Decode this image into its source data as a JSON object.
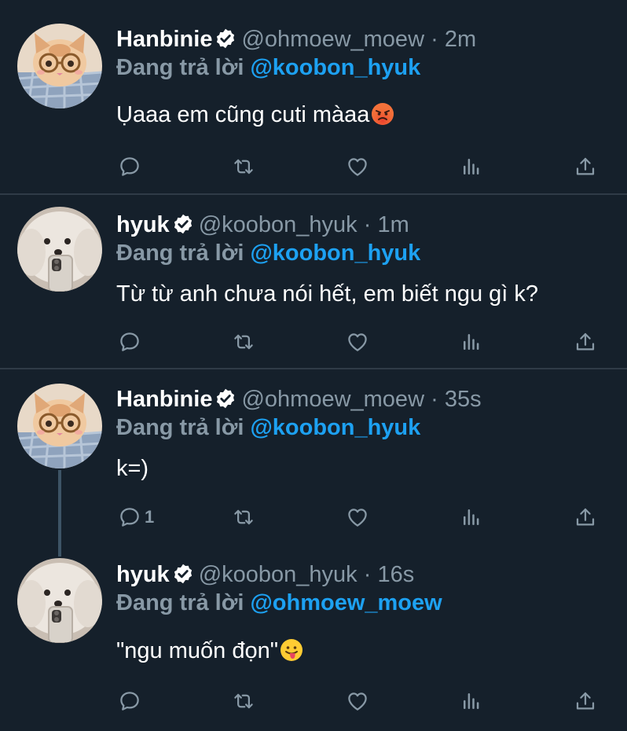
{
  "tweets": [
    {
      "name": "Hanbinie",
      "handle": "@ohmoew_moew",
      "dot": "·",
      "time": "2m",
      "reply_prefix": "Đang trả lời",
      "reply_to": "@koobon_hyuk",
      "text": "Ụaaa em cũng cuti màaa",
      "emoji": "angry-face",
      "reply_count": "",
      "avatar": "cat-avatar"
    },
    {
      "name": "hyuk",
      "handle": "@koobon_hyuk",
      "dot": "·",
      "time": "1m",
      "reply_prefix": "Đang trả lời",
      "reply_to": "@koobon_hyuk",
      "text": "Từ từ anh chưa nói hết, em biết ngu gì k?",
      "emoji": "",
      "reply_count": "",
      "avatar": "dog-avatar"
    },
    {
      "name": "Hanbinie",
      "handle": "@ohmoew_moew",
      "dot": "·",
      "time": "35s",
      "reply_prefix": "Đang trả lời",
      "reply_to": "@koobon_hyuk",
      "text": "k=)",
      "emoji": "",
      "reply_count": "1",
      "avatar": "cat-avatar"
    },
    {
      "name": "hyuk",
      "handle": "@koobon_hyuk",
      "dot": "·",
      "time": "16s",
      "reply_prefix": "Đang trả lời",
      "reply_to": "@ohmoew_moew",
      "text": "\"ngu muốn đọn\"",
      "emoji": "tongue-face",
      "reply_count": "",
      "avatar": "dog-avatar"
    }
  ],
  "colors": {
    "background": "#15202b",
    "text": "#ffffff",
    "muted": "#8899a6",
    "accent": "#1da1f2",
    "divider": "#2f3b47"
  },
  "icons": [
    "reply-icon",
    "retweet-icon",
    "like-icon",
    "analytics-icon",
    "share-icon",
    "verified-badge-icon"
  ]
}
